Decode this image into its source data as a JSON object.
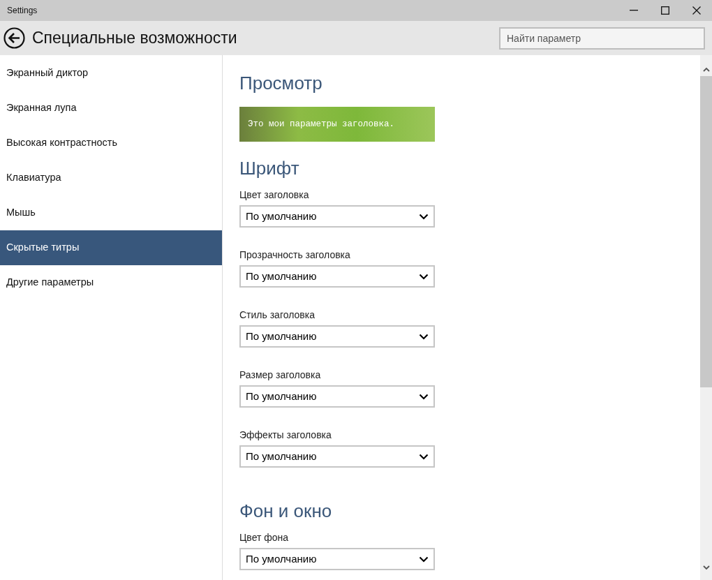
{
  "window": {
    "title": "Settings"
  },
  "header": {
    "title": "Специальные возможности",
    "search": {
      "placeholder": "Найти параметр"
    }
  },
  "sidebar": {
    "items": [
      {
        "label": "Экранный диктор",
        "selected": false
      },
      {
        "label": "Экранная лупа",
        "selected": false
      },
      {
        "label": "Высокая контрастность",
        "selected": false
      },
      {
        "label": "Клавиатура",
        "selected": false
      },
      {
        "label": "Мышь",
        "selected": false
      },
      {
        "label": "Скрытые титры",
        "selected": true
      },
      {
        "label": "Другие параметры",
        "selected": false
      }
    ]
  },
  "sections": [
    {
      "kind": "preview",
      "heading": "Просмотр",
      "caption": "Это мои параметры заголовка."
    },
    {
      "kind": "fields",
      "heading": "Шрифт",
      "fields": [
        {
          "label": "Цвет заголовка",
          "value": "По умолчанию"
        },
        {
          "label": "Прозрачность заголовка",
          "value": "По умолчанию"
        },
        {
          "label": "Стиль заголовка",
          "value": "По умолчанию"
        },
        {
          "label": "Размер заголовка",
          "value": "По умолчанию"
        },
        {
          "label": "Эффекты заголовка",
          "value": "По умолчанию"
        }
      ]
    },
    {
      "kind": "fields",
      "heading": "Фон и окно",
      "fields": [
        {
          "label": "Цвет фона",
          "value": "По умолчанию"
        }
      ]
    }
  ]
}
